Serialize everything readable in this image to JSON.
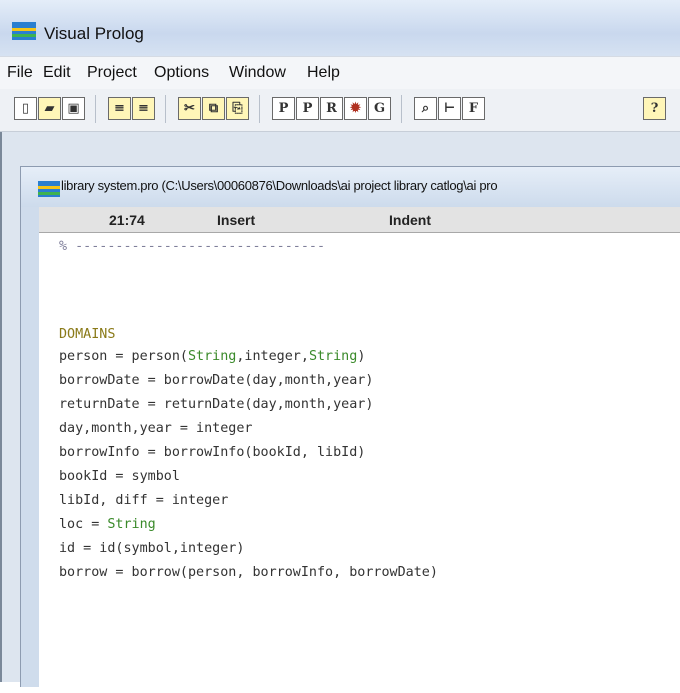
{
  "app": {
    "title": "Visual Prolog",
    "menu": [
      "File",
      "Edit",
      "Project",
      "Options",
      "Window",
      "Help"
    ]
  },
  "toolbar": {
    "buttons": [
      {
        "icon": "new-file-icon"
      },
      {
        "icon": "open-icon"
      },
      {
        "icon": "save-icon"
      },
      {
        "icon": "undo-icon"
      },
      {
        "icon": "redo-icon"
      },
      {
        "icon": "cut-icon"
      },
      {
        "icon": "copy-icon"
      },
      {
        "icon": "paste-icon"
      },
      {
        "icon": "p-icon",
        "label": "P"
      },
      {
        "icon": "project-p-icon",
        "label": "P"
      },
      {
        "icon": "run-r-icon",
        "label": "R"
      },
      {
        "icon": "debug-icon"
      },
      {
        "icon": "goal-g-icon",
        "label": "G"
      },
      {
        "icon": "browse-icon"
      },
      {
        "icon": "tree-icon"
      },
      {
        "icon": "find-f-icon",
        "label": "F"
      },
      {
        "icon": "help-icon",
        "label": "?"
      }
    ]
  },
  "editor_window": {
    "title": "library  system.pro (C:\\Users\\00060876\\Downloads\\ai project  library catlog\\ai pro",
    "status": {
      "position": "21:74",
      "mode": "Insert",
      "indent": "Indent"
    }
  },
  "code": {
    "separator": "% -------------------------------",
    "domains_keyword": "DOMAINS",
    "lines": [
      [
        "person = person(",
        "String",
        ",integer,",
        "String",
        ")"
      ],
      [
        "borrowDate = borrowDate(day,month,year)"
      ],
      [
        "returnDate = returnDate(day,month,year)"
      ],
      [
        "day,month,year = integer"
      ],
      [
        "borrowInfo = borrowInfo(bookId, libId)"
      ],
      [
        "bookId = symbol"
      ],
      [
        "libId, diff = integer"
      ],
      [
        "loc = ",
        "String"
      ],
      [
        "id = id(symbol,integer)"
      ],
      [
        "borrow = borrow(person, borrowInfo, borrowDate)"
      ]
    ]
  },
  "colors": {
    "keyword": "#8a7a18",
    "type": "#3a8a2a",
    "text": "#333333"
  }
}
